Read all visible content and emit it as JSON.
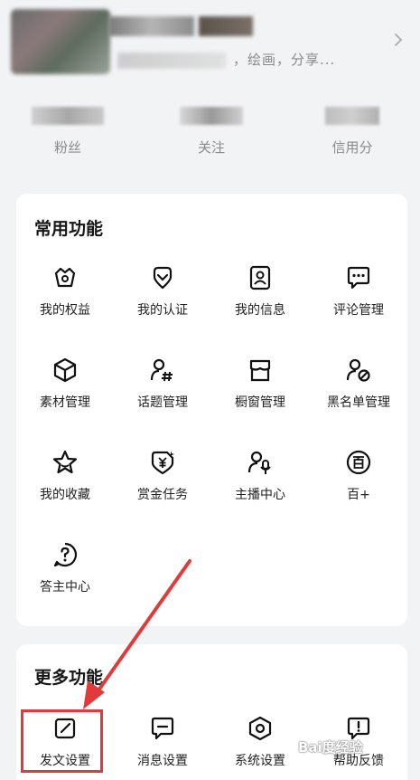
{
  "profile": {
    "bio": "，绘画，分享...",
    "stats": [
      {
        "label": "粉丝"
      },
      {
        "label": "关注"
      },
      {
        "label": "信用分"
      }
    ]
  },
  "common_functions": {
    "title": "常用功能",
    "items": [
      {
        "label": "我的权益",
        "icon": "crown-icon"
      },
      {
        "label": "我的认证",
        "icon": "heart-badge-icon"
      },
      {
        "label": "我的信息",
        "icon": "id-card-icon"
      },
      {
        "label": "评论管理",
        "icon": "chat-dots-icon"
      },
      {
        "label": "素材管理",
        "icon": "cube-icon"
      },
      {
        "label": "话题管理",
        "icon": "user-hashtag-icon"
      },
      {
        "label": "橱窗管理",
        "icon": "shop-window-icon"
      },
      {
        "label": "黑名单管理",
        "icon": "user-block-icon"
      },
      {
        "label": "我的收藏",
        "icon": "star-icon"
      },
      {
        "label": "赏金任务",
        "icon": "yuan-badge-icon"
      },
      {
        "label": "主播中心",
        "icon": "user-mic-icon"
      },
      {
        "label": "百+",
        "icon": "bai-plus-icon"
      },
      {
        "label": "答主中心",
        "icon": "question-icon"
      }
    ]
  },
  "more_functions": {
    "title": "更多功能",
    "items": [
      {
        "label": "发文设置",
        "icon": "edit-square-icon"
      },
      {
        "label": "消息设置",
        "icon": "message-icon"
      },
      {
        "label": "系统设置",
        "icon": "settings-hex-icon"
      },
      {
        "label": "帮助反馈",
        "icon": "feedback-icon"
      }
    ]
  },
  "watermark": "Bai度经验",
  "colors": {
    "background": "#f2f3f5",
    "card": "#ffffff",
    "annotation": "#e23a3a"
  }
}
